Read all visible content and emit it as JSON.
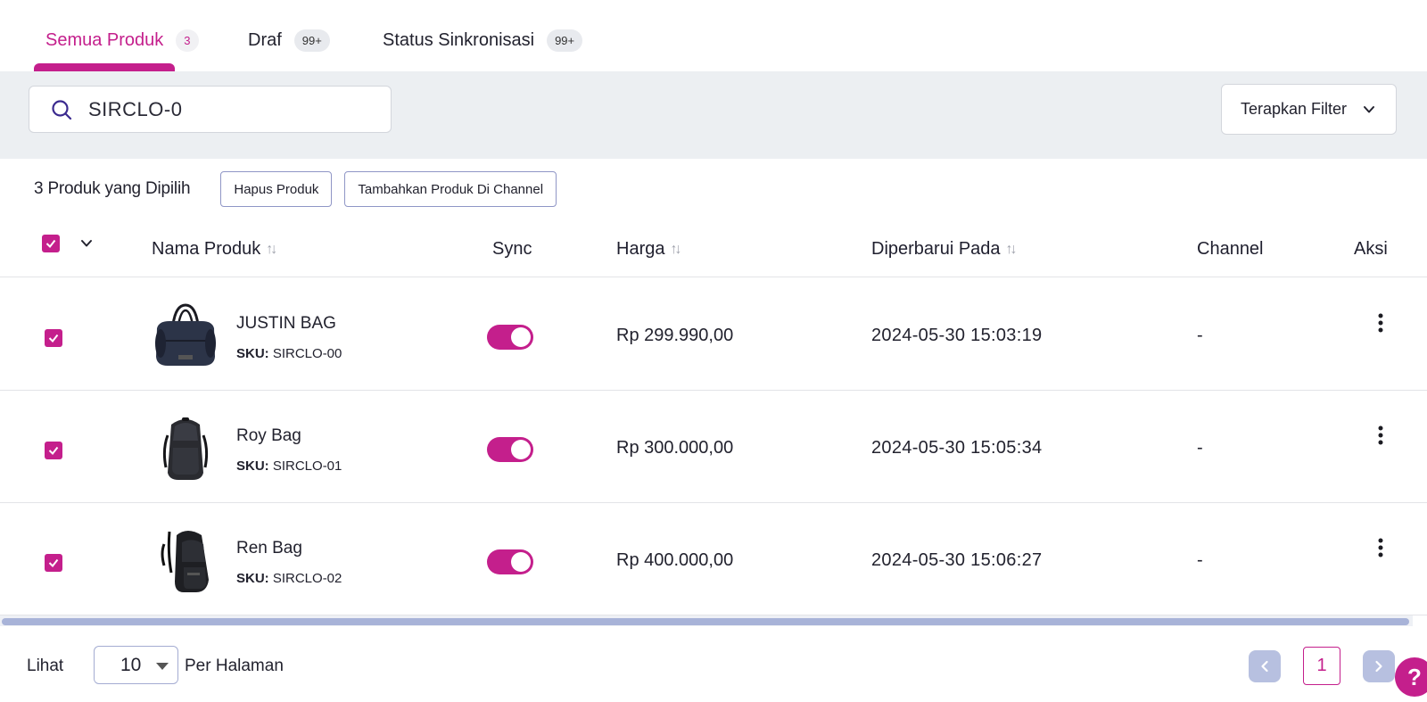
{
  "tabs": [
    {
      "label": "Semua Produk",
      "badge": "3",
      "active": true
    },
    {
      "label": "Draf",
      "badge": "99+",
      "active": false
    },
    {
      "label": "Status Sinkronisasi",
      "badge": "99+",
      "active": false
    }
  ],
  "search": {
    "value": "SIRCLO-0",
    "icon": "search-icon"
  },
  "filter": {
    "label": "Terapkan Filter",
    "icon": "chevron-down-icon"
  },
  "selection": {
    "count_label": "3 Produk yang Dipilih",
    "delete_label": "Hapus Produk",
    "add_channel_label": "Tambahkan Produk Di Channel"
  },
  "table": {
    "headers": {
      "name": "Nama Produk",
      "sync": "Sync",
      "price": "Harga",
      "updated": "Diperbarui Pada",
      "channel": "Channel",
      "action": "Aksi"
    },
    "sku_prefix": "SKU:",
    "rows": [
      {
        "name": "JUSTIN BAG",
        "sku": "SIRCLO-00",
        "sync": true,
        "price": "Rp 299.990,00",
        "updated": "2024-05-30 15:03:19",
        "channel": "-",
        "checked": true,
        "thumb": "duffel-bag"
      },
      {
        "name": "Roy Bag",
        "sku": "SIRCLO-01",
        "sync": true,
        "price": "Rp 300.000,00",
        "updated": "2024-05-30 15:05:34",
        "channel": "-",
        "checked": true,
        "thumb": "backpack"
      },
      {
        "name": "Ren Bag",
        "sku": "SIRCLO-02",
        "sync": true,
        "price": "Rp 400.000,00",
        "updated": "2024-05-30 15:06:27",
        "channel": "-",
        "checked": true,
        "thumb": "hiking-backpack"
      }
    ]
  },
  "footer": {
    "lihat_label": "Lihat",
    "page_size": "10",
    "per_page_label": "Per Halaman",
    "current_page": "1"
  },
  "help": {
    "label": "?"
  },
  "colors": {
    "accent": "#c41f8c",
    "band": "#eceff2",
    "pager": "#b7c0e0"
  }
}
